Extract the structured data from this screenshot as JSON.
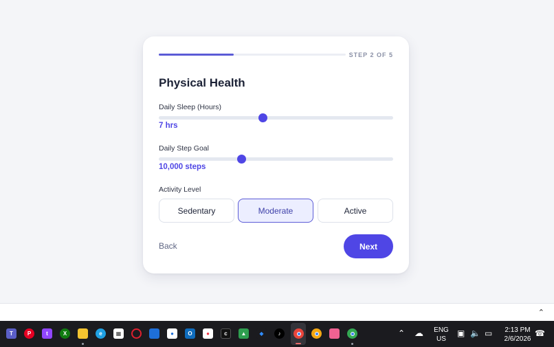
{
  "form": {
    "step_label": "STEP 2 OF 5",
    "progress_fraction": 0.4,
    "title": "Physical Health",
    "sleep": {
      "label": "Daily Sleep (Hours)",
      "value_text": "7 hrs",
      "slider_fraction": 0.445
    },
    "steps": {
      "label": "Daily Step Goal",
      "value_text": "10,000 steps",
      "slider_fraction": 0.353
    },
    "activity": {
      "label": "Activity Level",
      "options": [
        "Sedentary",
        "Moderate",
        "Active"
      ],
      "selected": "Moderate"
    },
    "back_label": "Back",
    "next_label": "Next"
  },
  "taskbar": {
    "apps": [
      "teams-icon",
      "pinterest-icon",
      "twitch-icon",
      "xbox-icon",
      "file-explorer-icon",
      "edge-icon",
      "store-icon",
      "opera-icon",
      "app-icon",
      "app-icon",
      "outlook-icon",
      "app-icon",
      "capcut-icon",
      "app-icon",
      "app-icon",
      "tiktok-icon",
      "chrome-icon",
      "chrome-icon",
      "app-icon",
      "chrome-icon"
    ],
    "language_line1": "ENG",
    "language_line2": "US",
    "time": "2:13 PM",
    "date": "2/6/2026"
  },
  "colors": {
    "accent": "#4f46e5",
    "card_bg": "#ffffff",
    "page_bg": "#f4f5f8",
    "taskbar_bg": "#1b1b1f"
  }
}
